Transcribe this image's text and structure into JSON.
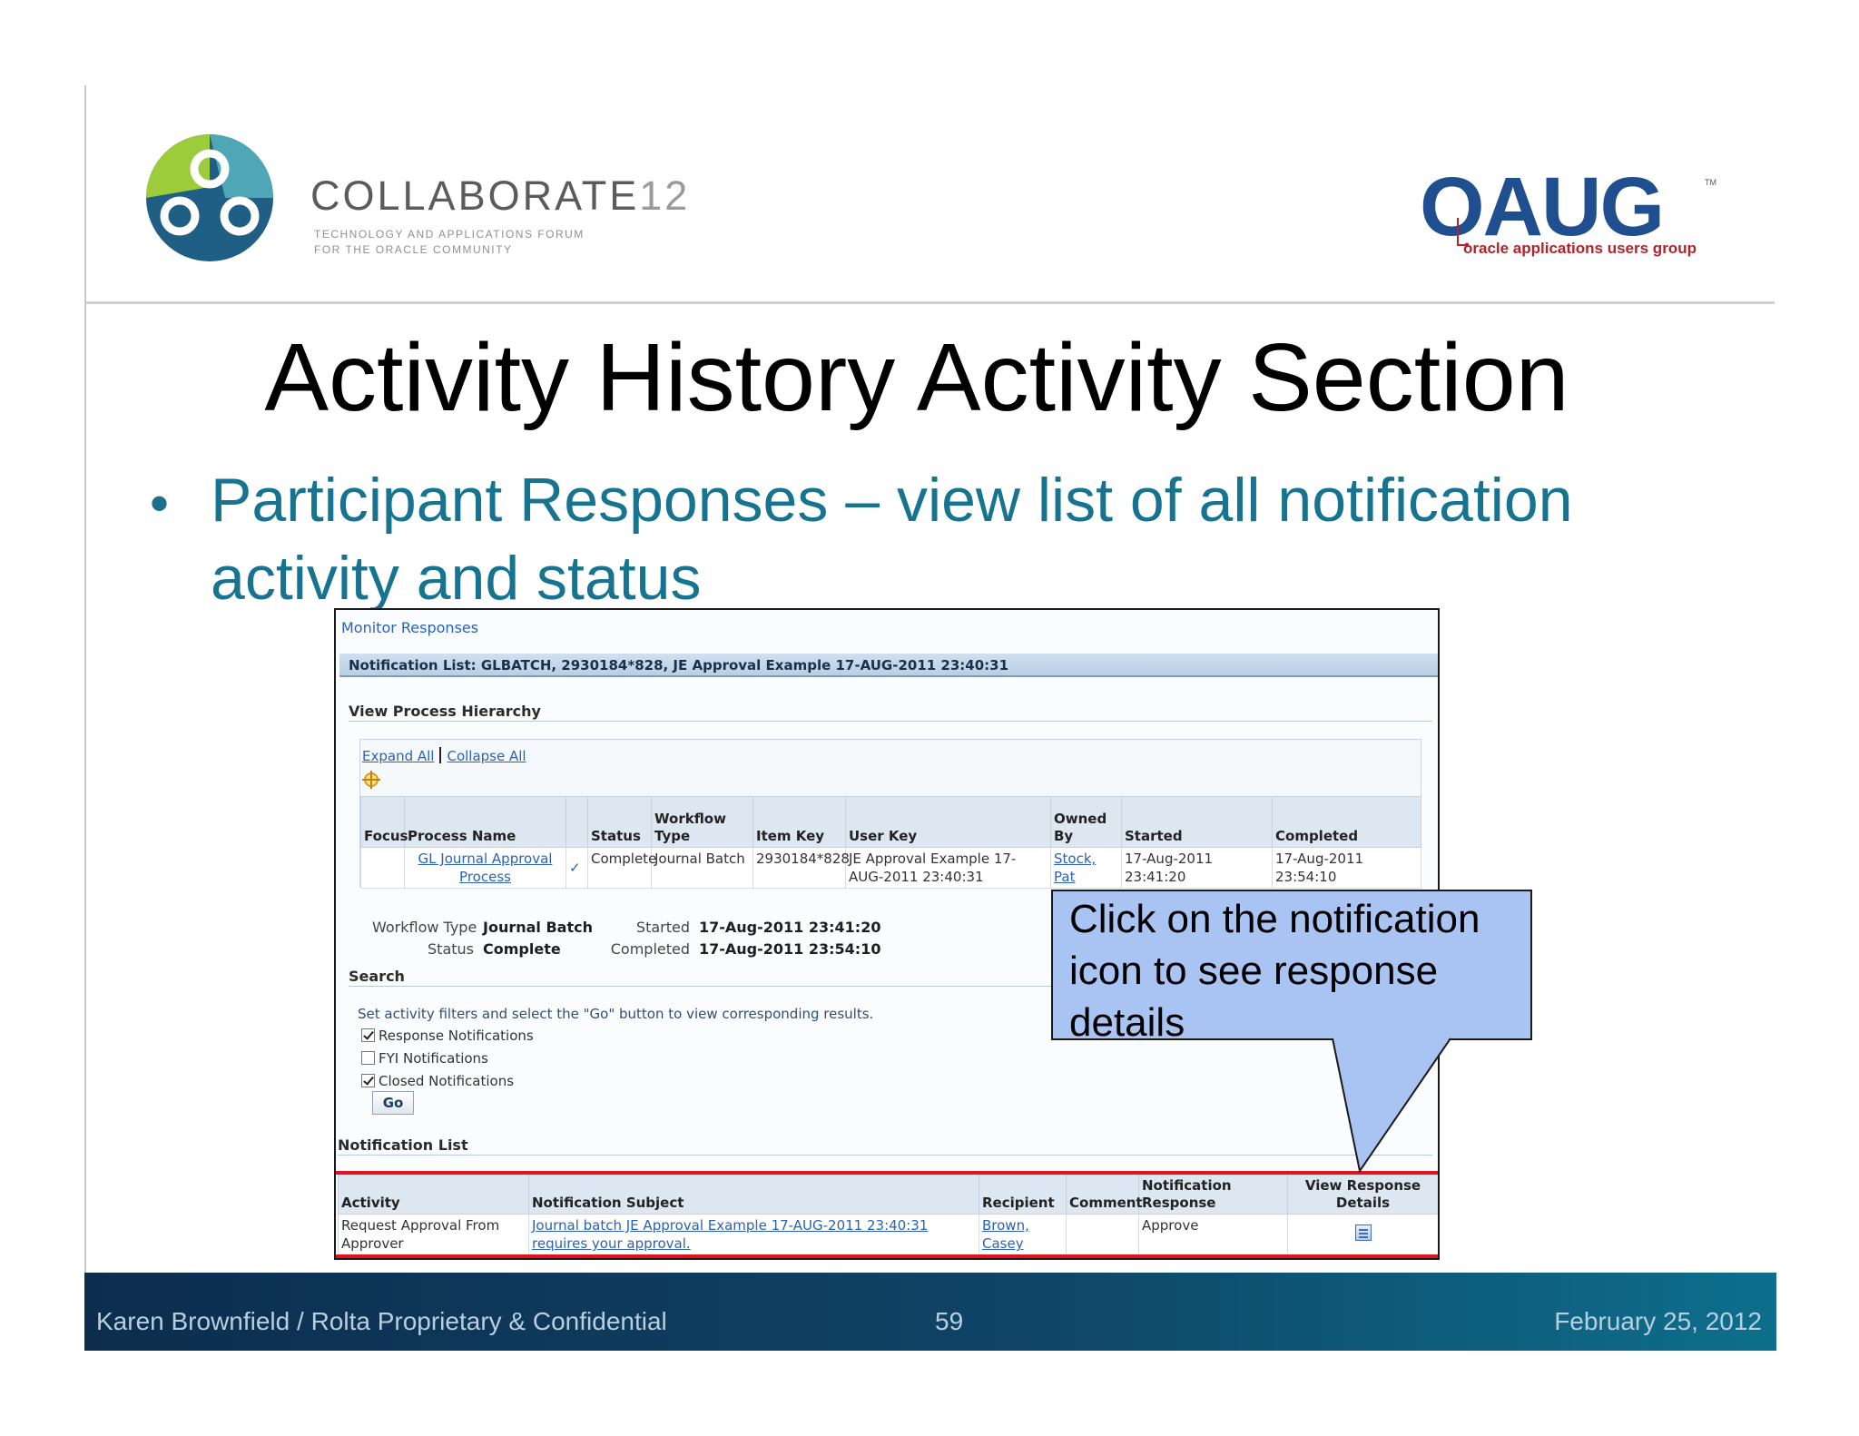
{
  "header": {
    "collaborate_word": "COLLABORATE",
    "collaborate_num": "12",
    "collaborate_tag_1": "Technology and Applications Forum",
    "collaborate_tag_2": "for the Oracle Community",
    "oaug_word": "OAUG",
    "oaug_tm": "TM",
    "oaug_tag": "oracle applications users group"
  },
  "slide": {
    "title": "Activity History Activity Section",
    "bullet": "Participant Responses – view list of all notification activity and status"
  },
  "screen": {
    "monitor_label": "Monitor Responses",
    "notification_header": "Notification List: GLBATCH, 2930184*828, JE Approval Example 17-AUG-2011 23:40:31",
    "hierarchy_title": "View Process Hierarchy",
    "expand_all": "Expand All",
    "collapse_all": "Collapse All",
    "process_table": {
      "headers": [
        "Focus",
        "Process Name",
        "",
        "Status",
        "Workflow Type",
        "Item Key",
        "User Key",
        "Owned By",
        "Started",
        "Completed"
      ],
      "row": {
        "process_name": "GL Journal Approval Process",
        "status": "Complete",
        "workflow_type": "Journal Batch",
        "item_key": "2930184*828",
        "user_key": "JE Approval Example 17-AUG-2011 23:40:31",
        "owned_by": "Stock, Pat",
        "started": "17-Aug-2011 23:41:20",
        "completed": "17-Aug-2011 23:54:10"
      }
    },
    "summary": {
      "workflow_type_label": "Workflow Type",
      "workflow_type_value": "Journal Batch",
      "status_label": "Status",
      "status_value": "Complete",
      "started_label": "Started",
      "started_value": "17-Aug-2011 23:41:20",
      "completed_label": "Completed",
      "completed_value": "17-Aug-2011 23:54:10"
    },
    "search": {
      "title": "Search",
      "hint": "Set activity filters and select the \"Go\" button to view corresponding results.",
      "filters": [
        {
          "label": "Response Notifications",
          "checked": true
        },
        {
          "label": "FYI Notifications",
          "checked": false
        },
        {
          "label": "Closed Notifications",
          "checked": true
        }
      ],
      "go_label": "Go"
    },
    "notification_list": {
      "title": "Notification List",
      "headers": [
        "Activity",
        "Notification Subject",
        "Recipient",
        "Comment",
        "Notification Response",
        "View Response Details"
      ],
      "row": {
        "activity": "Request Approval From Approver",
        "subject": "Journal batch JE Approval Example 17-AUG-2011 23:40:31 requires your approval.",
        "recipient": "Brown, Casey",
        "comment": "",
        "response": "Approve"
      }
    }
  },
  "callout": {
    "text": "Click on the notification icon to see response details"
  },
  "footer": {
    "author": "Karen Brownfield  /  Rolta  Proprietary & Confidential",
    "page": "59",
    "date": "February 25, 2012"
  },
  "colors": {
    "title": "#000000",
    "bullet": "#177490",
    "callout_fill": "#a9c3f2",
    "highlight_box": "#e0141d",
    "footer_start": "#0c2d4e",
    "footer_end": "#0d6f8c"
  }
}
